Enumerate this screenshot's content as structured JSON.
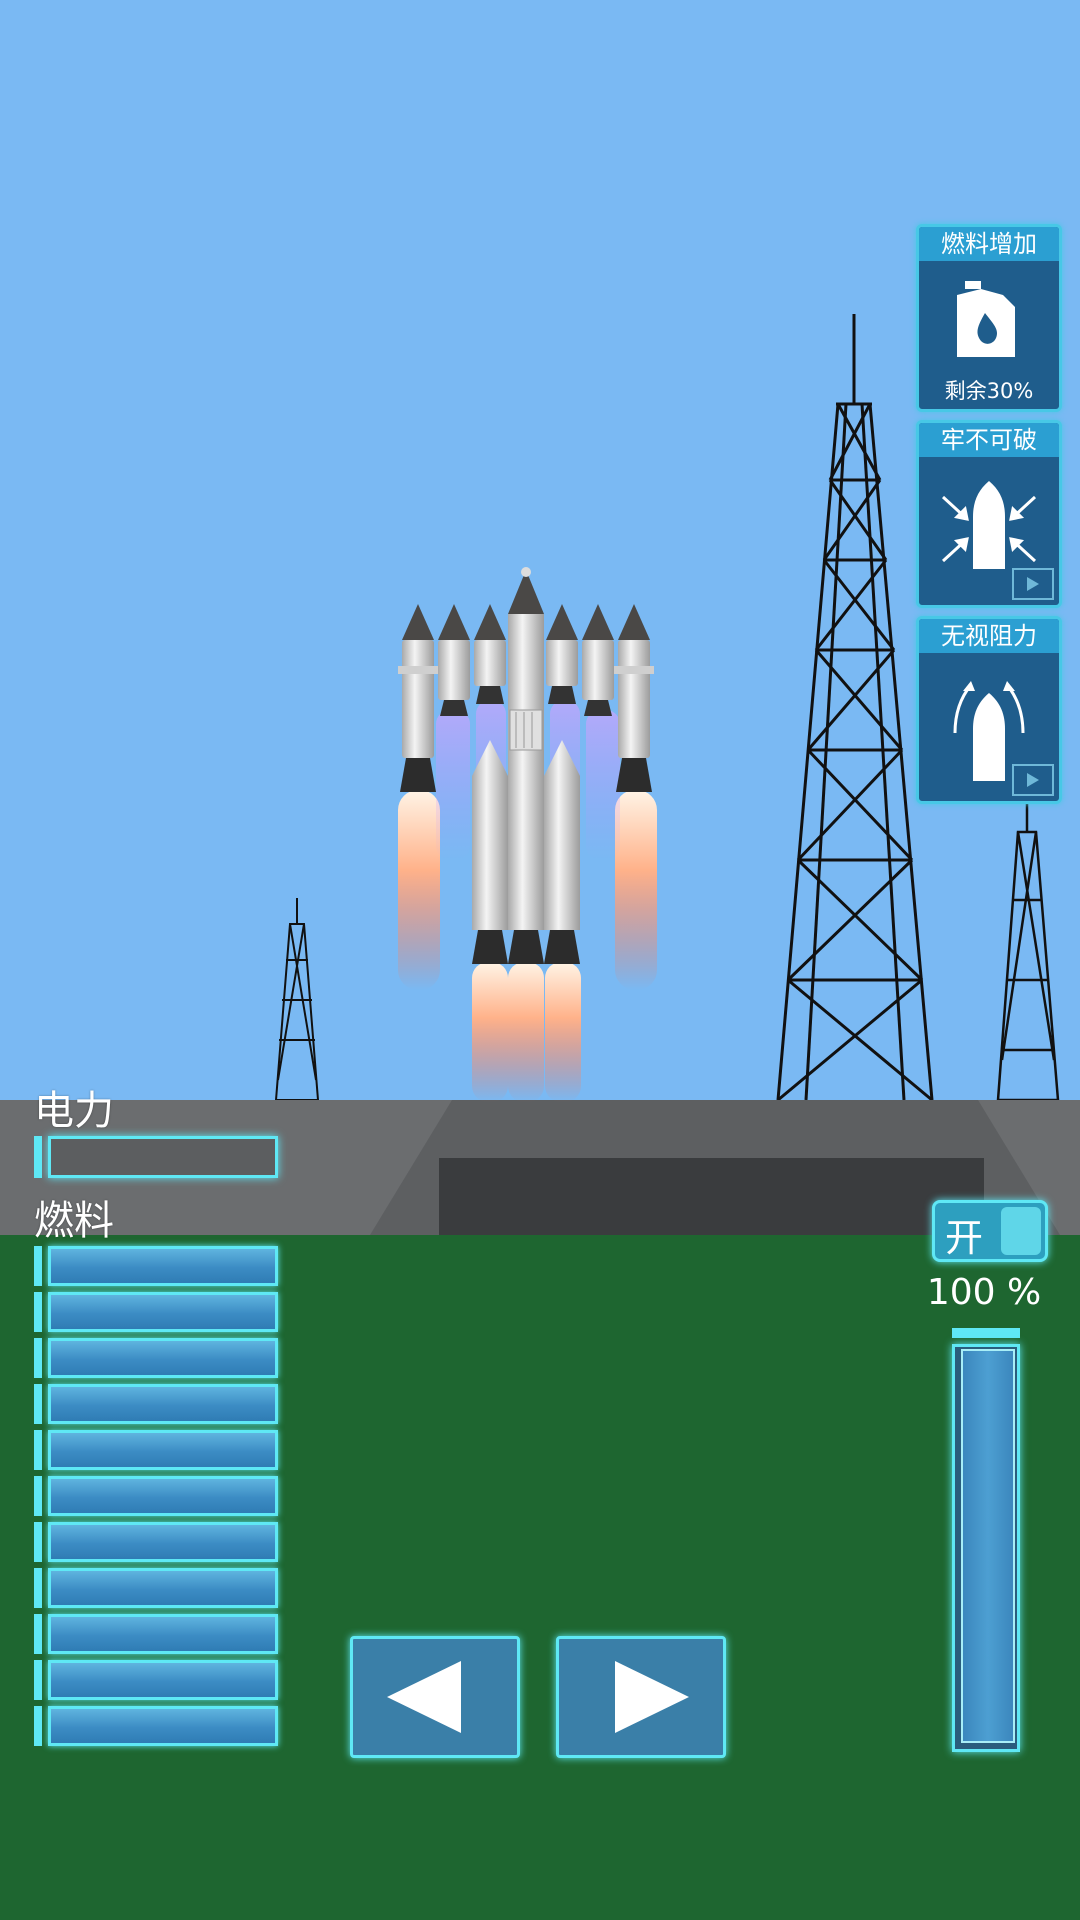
{
  "colors": {
    "sky": "#7ab9f3",
    "ground": "#1e6630",
    "pad": "#6b6d6f",
    "hud_accent": "#5fe8f5",
    "card_bg": "#1f5d8c",
    "card_title_bg": "#2b9fd2"
  },
  "hud": {
    "power_label": "电力",
    "power_level": 0,
    "fuel_label": "燃料",
    "fuel_cells": 11,
    "fuel_level": 1.0
  },
  "powerups": [
    {
      "title": "燃料增加",
      "icon": "fuel-can-icon",
      "subtitle": "剩余30%"
    },
    {
      "title": "牢不可破",
      "icon": "unbreakable-rocket-icon",
      "badge": "video-ad-icon"
    },
    {
      "title": "无视阻力",
      "icon": "no-drag-rocket-icon",
      "badge": "video-ad-icon"
    }
  ],
  "controls": {
    "left_icon": "arrow-left-icon",
    "right_icon": "arrow-right-icon"
  },
  "throttle": {
    "toggle_label": "开",
    "percent_text": "100 %",
    "level": 1.0
  }
}
